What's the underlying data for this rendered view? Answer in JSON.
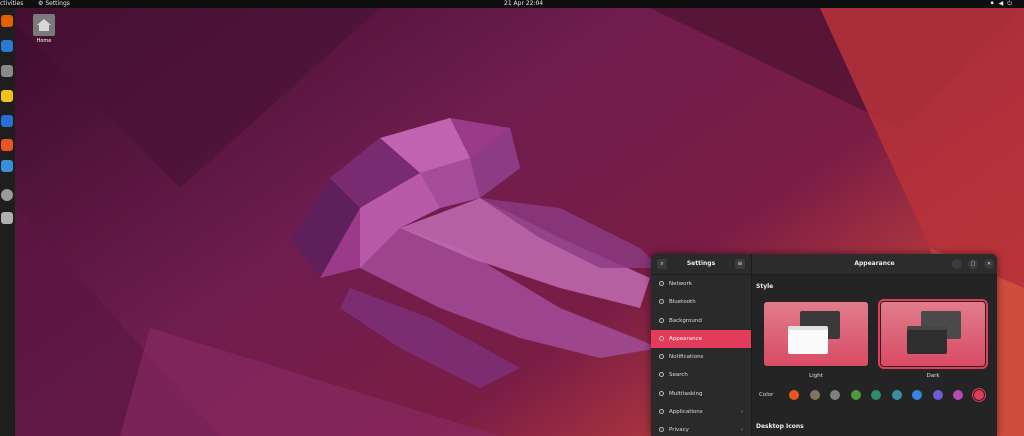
{
  "topbar": {
    "activities": "Activities",
    "app_name": "Settings",
    "clock": "21 Apr  22:04",
    "tray_icons": [
      "network-icon",
      "volume-icon",
      "power-icon"
    ]
  },
  "dock": {
    "icons": [
      {
        "name": "firefox-icon",
        "color": "#e66000"
      },
      {
        "name": "thunderbird-icon",
        "color": "#2a7ad4"
      },
      {
        "name": "files-icon",
        "color": "#8a8a8a"
      },
      {
        "name": "rhythmbox-icon",
        "color": "#f3c11b"
      },
      {
        "name": "writer-icon",
        "color": "#2a6fd6"
      },
      {
        "name": "app-center-icon",
        "color": "#e95420"
      },
      {
        "name": "help-icon",
        "color": "#3b8fd8"
      },
      {
        "name": "settings-icon",
        "color": "#9a9a9a"
      },
      {
        "name": "trash-icon",
        "color": "#b0b0b0"
      }
    ]
  },
  "desktop": {
    "home_label": "Home"
  },
  "settings": {
    "sidebar_title": "Settings",
    "nav": [
      {
        "label": "Network",
        "icon": "network-icon",
        "active": false
      },
      {
        "label": "Bluetooth",
        "icon": "bluetooth-icon",
        "active": false
      },
      {
        "label": "Background",
        "icon": "background-icon",
        "active": false
      },
      {
        "label": "Appearance",
        "icon": "appearance-icon",
        "active": true
      },
      {
        "label": "Notifications",
        "icon": "bell-icon",
        "active": false
      },
      {
        "label": "Search",
        "icon": "search-icon",
        "active": false
      },
      {
        "label": "Multitasking",
        "icon": "multitasking-icon",
        "active": false
      },
      {
        "label": "Applications",
        "icon": "grid-icon",
        "active": false,
        "has_chevron": true
      },
      {
        "label": "Privacy",
        "icon": "privacy-icon",
        "active": false,
        "has_chevron": true
      }
    ],
    "content_title": "Appearance",
    "style_title": "Style",
    "style_options": [
      {
        "label": "Light",
        "selected": false
      },
      {
        "label": "Dark",
        "selected": true
      }
    ],
    "color_label": "Color",
    "colors": [
      "#e95420",
      "#7f7560",
      "#808080",
      "#4e9a3c",
      "#2e8b6e",
      "#3a8fa0",
      "#3584e4",
      "#6f5ad6",
      "#b34cb3",
      "#e23c5a"
    ],
    "selected_color": "#e23c5a",
    "desktop_icons_title": "Desktop Icons"
  }
}
